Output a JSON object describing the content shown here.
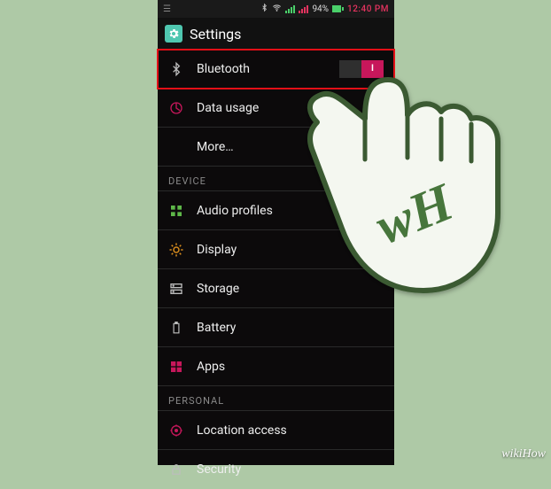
{
  "status_bar": {
    "bluetooth_icon": "bluetooth",
    "wifi_icon": "wifi",
    "battery_pct": "94%",
    "time": "12:40 PM"
  },
  "app_bar": {
    "title": "Settings",
    "icon": "gear"
  },
  "highlight_row": {
    "label": "Bluetooth",
    "toggle_on_label": "I"
  },
  "rows": {
    "data_usage": "Data usage",
    "more": "More…"
  },
  "sections": {
    "device": "DEVICE",
    "personal": "PERSONAL"
  },
  "device_rows": {
    "audio_profiles": "Audio profiles",
    "display": "Display",
    "storage": "Storage",
    "battery": "Battery",
    "apps": "Apps"
  },
  "personal_rows": {
    "location_access": "Location access",
    "security": "Security"
  },
  "hand_label": "wH",
  "watermark": "wikiHow"
}
